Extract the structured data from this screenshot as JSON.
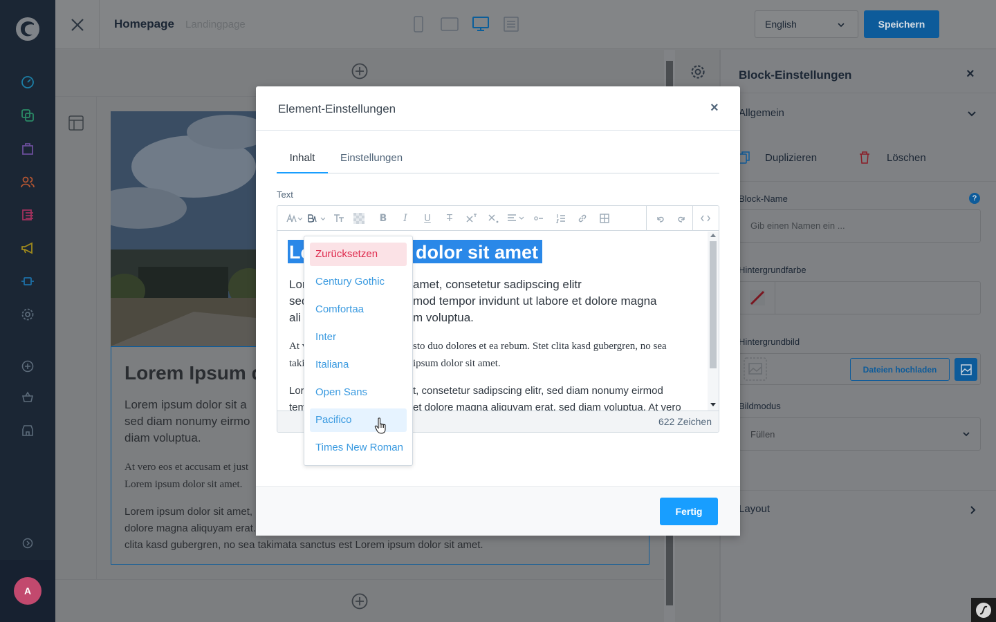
{
  "topbar": {
    "close_label": "×",
    "page_title": "Homepage",
    "page_subtitle": "Landingpage",
    "language": "English",
    "save_label": "Speichern"
  },
  "sidebar": {
    "avatar_initial": "A",
    "icons": [
      "dashboard-icon",
      "catalogue-icon",
      "orders-icon",
      "customers-icon",
      "content-icon",
      "marketing-icon",
      "extensions-icon",
      "settings-icon",
      "add-icon",
      "basket-icon",
      "store-icon",
      "help-icon"
    ]
  },
  "canvas": {
    "heading": "Lorem Ipsum d",
    "lead": "Lorem ipsum dolor sit a\nsed diam nonumy eirmo\ndiam voluptua.",
    "serif": "At vero eos et accusam et just\nLorem ipsum dolor sit amet.",
    "sans": "Lorem ipsum dolor sit amet,\ndolore magna aliquyam erat.\nclita kasd gubergren, no sea takimata sanctus est Lorem ipsum dolor sit amet."
  },
  "modal": {
    "title": "Element-Einstellungen",
    "close_label": "×",
    "tabs": [
      "Inhalt",
      "Einstellungen"
    ],
    "field_label": "Text",
    "editor": {
      "heading": "dolor sit amet",
      "heading_prefix": "Lo",
      "line1a": "Lor",
      "line1b": "amet, consetetur sadipscing elitr",
      "line2a": "sed",
      "line2b": "mod tempor invidunt ut labore et dolore magna",
      "line3a": "ali",
      "line3b": "m voluptua.",
      "serif1a": "At v",
      "serif1b": "sto duo dolores et ea rebum. Stet clita kasd gubergren, no sea",
      "serif2a": "taki",
      "serif2b": "ipsum dolor sit amet.",
      "sans1a": "Lor",
      "sans1b": "t, consetetur sadipscing elitr, sed diam nonumy eirmod",
      "sans2a": "tem",
      "sans2b": "et dolore magna aliquyam erat, sed diam voluptua. At vero"
    },
    "char_count": "622 Zeichen",
    "done_label": "Fertig",
    "font_menu": [
      "Zurücksetzen",
      "Century Gothic",
      "Comfortaa",
      "Inter",
      "Italiana",
      "Open Sans",
      "Pacifico",
      "Times New Roman"
    ]
  },
  "right_panel": {
    "title": "Block-Einstellungen",
    "close_label": "×",
    "section_general": "Allgemein",
    "duplicate_label": "Duplizieren",
    "delete_label": "Löschen",
    "block_name_label": "Block-Name",
    "block_name_placeholder": "Gib einen Namen ein ...",
    "bg_color_label": "Hintergrundfarbe",
    "bg_image_label": "Hintergrundbild",
    "upload_label": "Dateien hochladen",
    "image_mode_label": "Bildmodus",
    "image_mode_value": "Füllen",
    "layout_label": "Layout"
  },
  "colors": {
    "accent": "#189eff",
    "reset_bg": "#fbe2e6",
    "reset_text": "#de294c",
    "selection": "#2a88e8"
  }
}
